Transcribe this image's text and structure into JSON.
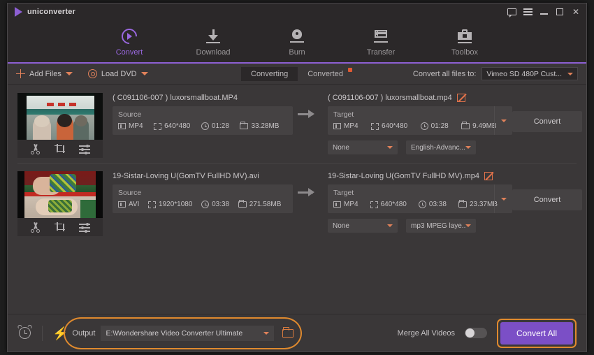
{
  "window": {
    "brand": "uniconverter",
    "controls": [
      {
        "name": "message-icon",
        "label": "⬜"
      },
      {
        "name": "menu-icon",
        "label": "≡"
      },
      {
        "name": "minimize-button",
        "label": "–"
      },
      {
        "name": "maximize-button",
        "label": "□"
      },
      {
        "name": "close-button",
        "label": "✕"
      }
    ]
  },
  "nav": {
    "items": [
      {
        "label": "Convert",
        "icon": "convert-icon",
        "active": true
      },
      {
        "label": "Download",
        "icon": "download-icon",
        "active": false
      },
      {
        "label": "Burn",
        "icon": "burn-icon",
        "active": false
      },
      {
        "label": "Transfer",
        "icon": "transfer-icon",
        "active": false
      },
      {
        "label": "Toolbox",
        "icon": "toolbox-icon",
        "active": false
      }
    ]
  },
  "toolbar": {
    "add_files_label": "Add Files",
    "load_dvd_label": "Load DVD",
    "tab_converting": "Converting",
    "tab_converted": "Converted",
    "converted_badge": "",
    "convert_all_to_label": "Convert all files to:",
    "convert_all_to_value": "Vimeo SD 480P Cust..."
  },
  "files": [
    {
      "source_name": "( C091106-007 )  luxorsmallboat.MP4",
      "target_name": "( C091106-007 )  luxorsmallboat.mp4",
      "source_title": "Source",
      "target_title": "Target",
      "source": {
        "format": "MP4",
        "resolution": "640*480",
        "duration": "01:28",
        "size": "33.28MB"
      },
      "target": {
        "format": "MP4",
        "resolution": "640*480",
        "duration": "01:28",
        "size": "9.49MB"
      },
      "subtitle": "None",
      "audio": "English-Advanc...",
      "convert_label": "Convert",
      "tools": [
        "trim-icon",
        "crop-icon",
        "effects-icon"
      ]
    },
    {
      "source_name": "19-Sistar-Loving U(GomTV FullHD MV).avi",
      "target_name": "19-Sistar-Loving U(GomTV FullHD MV).mp4",
      "source_title": "Source",
      "target_title": "Target",
      "source": {
        "format": "AVI",
        "resolution": "1920*1080",
        "duration": "03:38",
        "size": "271.58MB"
      },
      "target": {
        "format": "MP4",
        "resolution": "640*480",
        "duration": "03:38",
        "size": "23.37MB"
      },
      "subtitle": "None",
      "audio": "mp3 MPEG laye...",
      "convert_label": "Convert",
      "tools": [
        "trim-icon",
        "crop-icon",
        "effects-icon"
      ]
    }
  ],
  "bottom": {
    "output_label": "Output",
    "output_path": "E:\\Wondershare Video Converter Ultimate",
    "merge_label": "Merge All Videos",
    "merge_on": false,
    "convert_all_label": "Convert All"
  },
  "colors": {
    "accent_purple": "#7b4fc6",
    "nav_active": "#9a68e0",
    "accent_orange": "#e0815a",
    "highlight_ring": "#e08a2e",
    "badge_red": "#e05a33",
    "panel_bg": "#454243",
    "window_bg": "#2e2c2d",
    "bar_bg": "#3a3738"
  }
}
